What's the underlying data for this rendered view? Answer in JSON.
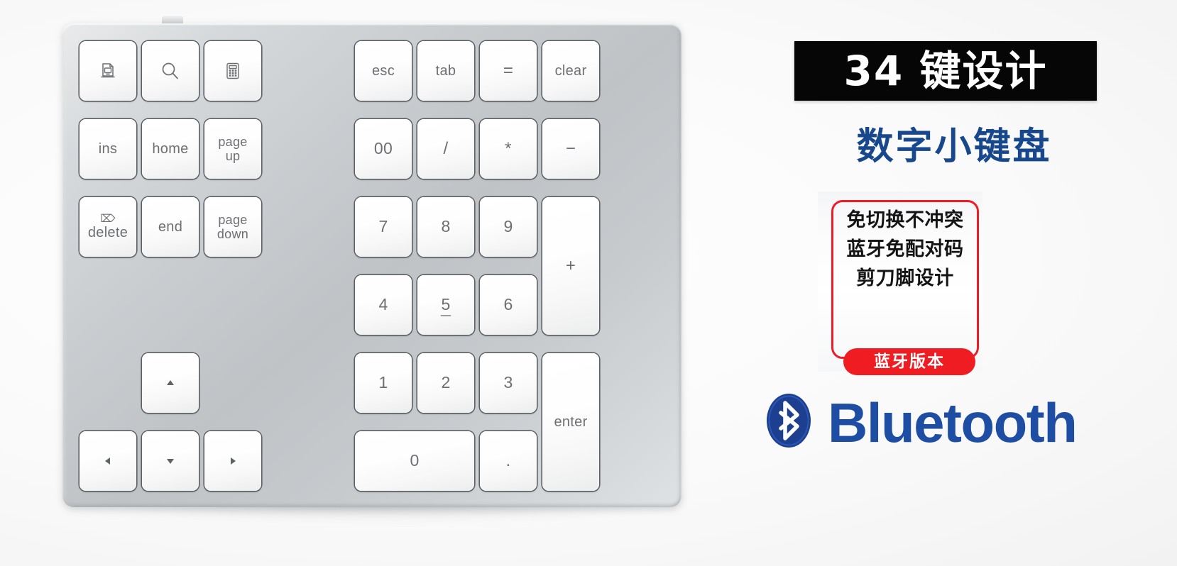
{
  "product": {
    "device_name": "numeric-keypad"
  },
  "keyboard": {
    "keys": [
      {
        "id": "screenshot",
        "label": "",
        "icon": "screenshot-icon",
        "col": 0,
        "row": 0,
        "w": 1,
        "h": 1,
        "group": "left"
      },
      {
        "id": "search",
        "label": "",
        "icon": "magnifier-icon",
        "col": 1,
        "row": 0,
        "w": 1,
        "h": 1,
        "group": "left"
      },
      {
        "id": "calculator",
        "label": "",
        "icon": "calculator-icon",
        "col": 2,
        "row": 0,
        "w": 1,
        "h": 1,
        "group": "left"
      },
      {
        "id": "ins",
        "label": "ins",
        "icon": "",
        "col": 0,
        "row": 1,
        "w": 1,
        "h": 1,
        "group": "left"
      },
      {
        "id": "home",
        "label": "home",
        "icon": "",
        "col": 1,
        "row": 1,
        "w": 1,
        "h": 1,
        "group": "left"
      },
      {
        "id": "page-up",
        "label": "page\nup",
        "icon": "",
        "col": 2,
        "row": 1,
        "w": 1,
        "h": 1,
        "group": "left"
      },
      {
        "id": "delete",
        "label": "delete",
        "icon": "delete-icon",
        "col": 0,
        "row": 2,
        "w": 1,
        "h": 1,
        "group": "left"
      },
      {
        "id": "end",
        "label": "end",
        "icon": "",
        "col": 1,
        "row": 2,
        "w": 1,
        "h": 1,
        "group": "left"
      },
      {
        "id": "page-down",
        "label": "page\ndown",
        "icon": "",
        "col": 2,
        "row": 2,
        "w": 1,
        "h": 1,
        "group": "left"
      },
      {
        "id": "arrow-up",
        "label": "",
        "icon": "arrow-up-icon",
        "col": 1,
        "row": 4,
        "w": 1,
        "h": 1,
        "group": "left"
      },
      {
        "id": "arrow-left",
        "label": "",
        "icon": "arrow-left-icon",
        "col": 0,
        "row": 5,
        "w": 1,
        "h": 1,
        "group": "left"
      },
      {
        "id": "arrow-down",
        "label": "",
        "icon": "arrow-down-icon",
        "col": 1,
        "row": 5,
        "w": 1,
        "h": 1,
        "group": "left"
      },
      {
        "id": "arrow-right",
        "label": "",
        "icon": "arrow-right-icon",
        "col": 2,
        "row": 5,
        "w": 1,
        "h": 1,
        "group": "left"
      },
      {
        "id": "esc",
        "label": "esc",
        "icon": "",
        "col": 0,
        "row": 0,
        "w": 1,
        "h": 1,
        "group": "right"
      },
      {
        "id": "tab",
        "label": "tab",
        "icon": "",
        "col": 1,
        "row": 0,
        "w": 1,
        "h": 1,
        "group": "right"
      },
      {
        "id": "equals",
        "label": "=",
        "icon": "",
        "col": 2,
        "row": 0,
        "w": 1,
        "h": 1,
        "group": "right"
      },
      {
        "id": "clear",
        "label": "clear",
        "icon": "",
        "col": 3,
        "row": 0,
        "w": 1,
        "h": 1,
        "group": "right"
      },
      {
        "id": "double-zero",
        "label": "00",
        "icon": "",
        "col": 0,
        "row": 1,
        "w": 1,
        "h": 1,
        "group": "right"
      },
      {
        "id": "divide",
        "label": "/",
        "icon": "",
        "col": 1,
        "row": 1,
        "w": 1,
        "h": 1,
        "group": "right"
      },
      {
        "id": "multiply",
        "label": "*",
        "icon": "",
        "col": 2,
        "row": 1,
        "w": 1,
        "h": 1,
        "group": "right"
      },
      {
        "id": "minus",
        "label": "−",
        "icon": "",
        "col": 3,
        "row": 1,
        "w": 1,
        "h": 1,
        "group": "right"
      },
      {
        "id": "num-7",
        "label": "7",
        "icon": "",
        "col": 0,
        "row": 2,
        "w": 1,
        "h": 1,
        "group": "right"
      },
      {
        "id": "num-8",
        "label": "8",
        "icon": "",
        "col": 1,
        "row": 2,
        "w": 1,
        "h": 1,
        "group": "right"
      },
      {
        "id": "num-9",
        "label": "9",
        "icon": "",
        "col": 2,
        "row": 2,
        "w": 1,
        "h": 1,
        "group": "right"
      },
      {
        "id": "plus",
        "label": "+",
        "icon": "",
        "col": 3,
        "row": 2,
        "w": 1,
        "h": 2,
        "group": "right"
      },
      {
        "id": "num-4",
        "label": "4",
        "icon": "",
        "col": 0,
        "row": 3,
        "w": 1,
        "h": 1,
        "group": "right"
      },
      {
        "id": "num-5",
        "label": "5",
        "icon": "",
        "col": 1,
        "row": 3,
        "w": 1,
        "h": 1,
        "group": "right",
        "home_marker": true
      },
      {
        "id": "num-6",
        "label": "6",
        "icon": "",
        "col": 2,
        "row": 3,
        "w": 1,
        "h": 1,
        "group": "right"
      },
      {
        "id": "num-1",
        "label": "1",
        "icon": "",
        "col": 0,
        "row": 4,
        "w": 1,
        "h": 1,
        "group": "right"
      },
      {
        "id": "num-2",
        "label": "2",
        "icon": "",
        "col": 1,
        "row": 4,
        "w": 1,
        "h": 1,
        "group": "right"
      },
      {
        "id": "num-3",
        "label": "3",
        "icon": "",
        "col": 2,
        "row": 4,
        "w": 1,
        "h": 1,
        "group": "right"
      },
      {
        "id": "enter",
        "label": "enter",
        "icon": "",
        "col": 3,
        "row": 4,
        "w": 1,
        "h": 2,
        "group": "right"
      },
      {
        "id": "num-0",
        "label": "0",
        "icon": "",
        "col": 0,
        "row": 5,
        "w": 2,
        "h": 1,
        "group": "right"
      },
      {
        "id": "decimal",
        "label": ".",
        "icon": "",
        "col": 2,
        "row": 5,
        "w": 1,
        "h": 1,
        "group": "right"
      }
    ]
  },
  "marketing": {
    "headline": "34 键设计",
    "subheadline": "数字小键盘",
    "features": [
      "免切换不冲突",
      "蓝牙免配对码",
      "剪刀脚设计"
    ],
    "version_badge": "蓝牙版本",
    "bluetooth_wordmark": "Bluetooth"
  },
  "colors": {
    "banner_background": "#060606",
    "banner_text": "#ffffff",
    "subheadline_text": "#17478c",
    "feature_border": "#ee1c25",
    "feature_text": "#141414",
    "badge_background": "#ef1c22",
    "badge_text": "#ffffff",
    "bluetooth_blue": "#1d4ea4",
    "key_face": "#ffffff",
    "key_legend": "#6c6f73",
    "keyboard_body": "#c6cacd"
  }
}
